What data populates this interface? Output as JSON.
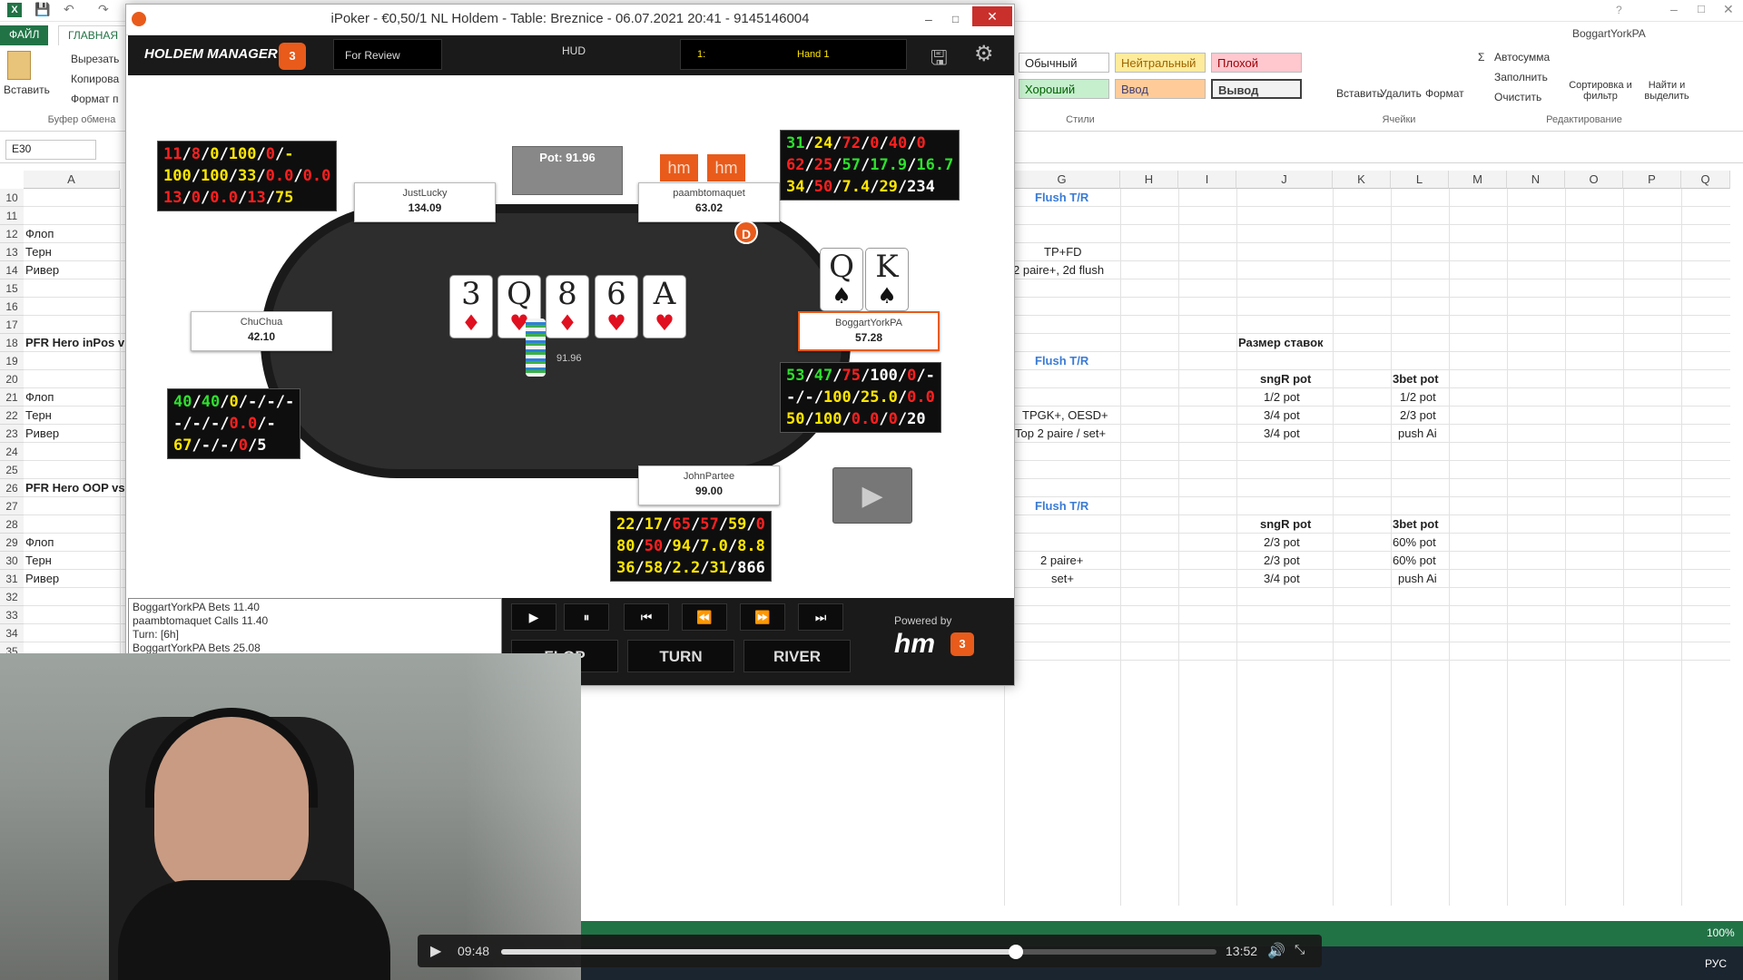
{
  "excel": {
    "tabs": {
      "file": "ФАЙЛ",
      "home": "ГЛАВНАЯ"
    },
    "user": "BoggartYorkPA",
    "clipboard": {
      "paste": "Вставить",
      "cut": "Вырезать",
      "copy": "Копирова",
      "format": "Формат п",
      "group": "Буфер обмена"
    },
    "styles": {
      "normal": "Обычный",
      "neutral": "Нейтральный",
      "bad": "Плохой",
      "good": "Хороший",
      "input": "Ввод",
      "output": "Вывод",
      "group": "Стили"
    },
    "cells_group": {
      "insert": "Вставить",
      "delete": "Удалить",
      "format": "Формат",
      "group": "Ячейки"
    },
    "editing": {
      "autosum": "Автосумма",
      "fill": "Заполнить",
      "clear": "Очистить",
      "sort": "Сортировка и фильтр",
      "find": "Найти и выделить",
      "group": "Редактирование"
    },
    "name_box": "E30",
    "columns": [
      "A",
      "G",
      "H",
      "I",
      "J",
      "K",
      "L",
      "M",
      "N",
      "O",
      "P",
      "Q"
    ],
    "rows": [
      "10",
      "11",
      "12",
      "13",
      "14",
      "15",
      "16",
      "17",
      "18",
      "19",
      "20",
      "21",
      "22",
      "23",
      "24",
      "25",
      "26",
      "27",
      "28",
      "29",
      "30",
      "31",
      "32",
      "33",
      "34",
      "35"
    ],
    "col_a": {
      "r12": "Флоп",
      "r13": "Терн",
      "r14": "Ривер",
      "r18": "PFR Hero inPos v",
      "r21": "Флоп",
      "r22": "Терн",
      "r23": "Ривер",
      "r26": "PFR Hero OOP vs",
      "r29": "Флоп",
      "r30": "Терн",
      "r31": "Ривер"
    },
    "col_g": {
      "r10": "Flush T/R",
      "r13": "TP+FD",
      "r14": "2 paire+, 2d flush",
      "r19": "Flush T/R",
      "r22": "TPGK+, OESD+",
      "r23": "Top 2 paire / set+",
      "r27": "Flush T/R",
      "r30": "2 paire+",
      "r31": "set+"
    },
    "bet_sizes_header": "Размер ставок",
    "col_j": {
      "r20": "sngR pot",
      "r21": "1/2 pot",
      "r22": "3/4 pot",
      "r23": "3/4 pot",
      "r28": "sngR pot",
      "r29": "2/3 pot",
      "r30": "2/3 pot",
      "r31": "3/4 pot"
    },
    "col_l": {
      "r20": "3bet pot",
      "r21": "1/2 pot",
      "r22": "2/3 pot",
      "r23": "push Ai",
      "r28": "3bet pot",
      "r29": "60% pot",
      "r30": "60% pot",
      "r31": "push Ai"
    },
    "zoom": "100%",
    "lang": "РУС"
  },
  "hm": {
    "title": "iPoker - €0,50/1 NL Holdem - Table: Breznice - 06.07.2021 20:41 - 9145146004",
    "logo": "HOLDEM MANAGER",
    "review_label": "For Review",
    "hud_label": "HUD",
    "hand_label": "Hand 1",
    "hand_index": "1:",
    "pot": "Pot: 91.96",
    "pot_chips": "91.96",
    "dealer": "D",
    "hm_badge": "hm",
    "seats": [
      {
        "name": "JustLucky",
        "stack": "134.09"
      },
      {
        "name": "paambtomaquet",
        "stack": "63.02"
      },
      {
        "name": "ChuChua",
        "stack": "42.10"
      },
      {
        "name": "BoggartYorkPA",
        "stack": "57.28"
      },
      {
        "name": "JohnPartee",
        "stack": "99.00"
      }
    ],
    "board": [
      {
        "rank": "3",
        "suit": "♦"
      },
      {
        "rank": "Q",
        "suit": "♥"
      },
      {
        "rank": "8",
        "suit": "♦"
      },
      {
        "rank": "6",
        "suit": "♥"
      },
      {
        "rank": "A",
        "suit": "♥"
      }
    ],
    "hero_cards": [
      {
        "rank": "Q",
        "suit": "♠"
      },
      {
        "rank": "K",
        "suit": "♠"
      }
    ],
    "hud_justlucky": [
      [
        [
          "r",
          "11"
        ],
        [
          "w",
          "/"
        ],
        [
          "r",
          "8"
        ],
        [
          "w",
          "/"
        ],
        [
          "y",
          "0"
        ],
        [
          "w",
          "/"
        ],
        [
          "y",
          "100"
        ],
        [
          "w",
          "/"
        ],
        [
          "r",
          "0"
        ],
        [
          "w",
          "/"
        ],
        [
          "y",
          "-"
        ]
      ],
      [
        [
          "y",
          "100"
        ],
        [
          "w",
          "/"
        ],
        [
          "y",
          "100"
        ],
        [
          "w",
          "/"
        ],
        [
          "y",
          "33"
        ],
        [
          "w",
          "/"
        ],
        [
          "r",
          "0.0"
        ],
        [
          "w",
          "/"
        ],
        [
          "r",
          "0.0"
        ]
      ],
      [
        [
          "r",
          "13"
        ],
        [
          "w",
          "/"
        ],
        [
          "r",
          "0"
        ],
        [
          "w",
          "/"
        ],
        [
          "r",
          "0.0"
        ],
        [
          "w",
          "/"
        ],
        [
          "r",
          "13"
        ],
        [
          "w",
          "/"
        ],
        [
          "y",
          "75"
        ]
      ]
    ],
    "hud_paamb": [
      [
        [
          "g",
          "31"
        ],
        [
          "w",
          "/"
        ],
        [
          "y",
          "24"
        ],
        [
          "w",
          "/"
        ],
        [
          "r",
          "72"
        ],
        [
          "w",
          "/"
        ],
        [
          "r",
          "0"
        ],
        [
          "w",
          "/"
        ],
        [
          "r",
          "40"
        ],
        [
          "w",
          "/"
        ],
        [
          "r",
          "0"
        ]
      ],
      [
        [
          "r",
          "62"
        ],
        [
          "w",
          "/"
        ],
        [
          "r",
          "25"
        ],
        [
          "w",
          "/"
        ],
        [
          "g",
          "57"
        ],
        [
          "w",
          "/"
        ],
        [
          "g",
          "17.9"
        ],
        [
          "w",
          "/"
        ],
        [
          "g",
          "16.7"
        ]
      ],
      [
        [
          "y",
          "34"
        ],
        [
          "w",
          "/"
        ],
        [
          "r",
          "50"
        ],
        [
          "w",
          "/"
        ],
        [
          "y",
          "7.4"
        ],
        [
          "w",
          "/"
        ],
        [
          "y",
          "29"
        ],
        [
          "w",
          "/"
        ],
        [
          "w",
          "234"
        ]
      ]
    ],
    "hud_chuchua": [
      [
        [
          "g",
          "40"
        ],
        [
          "w",
          "/"
        ],
        [
          "g",
          "40"
        ],
        [
          "w",
          "/"
        ],
        [
          "y",
          "0"
        ],
        [
          "w",
          "/"
        ],
        [
          "w",
          "-"
        ],
        [
          "w",
          "/"
        ],
        [
          "w",
          "-"
        ],
        [
          "w",
          "/"
        ],
        [
          "w",
          "-"
        ]
      ],
      [
        [
          "w",
          "-"
        ],
        [
          "w",
          "/"
        ],
        [
          "w",
          "-"
        ],
        [
          "w",
          "/"
        ],
        [
          "w",
          "-"
        ],
        [
          "w",
          "/"
        ],
        [
          "r",
          "0.0"
        ],
        [
          "w",
          "/"
        ],
        [
          "w",
          "-"
        ]
      ],
      [
        [
          "y",
          "67"
        ],
        [
          "w",
          "/"
        ],
        [
          "w",
          "-"
        ],
        [
          "w",
          "/"
        ],
        [
          "w",
          "-"
        ],
        [
          "w",
          "/"
        ],
        [
          "r",
          "0"
        ],
        [
          "w",
          "/"
        ],
        [
          "w",
          "5"
        ]
      ]
    ],
    "hud_boggart": [
      [
        [
          "g",
          "53"
        ],
        [
          "w",
          "/"
        ],
        [
          "g",
          "47"
        ],
        [
          "w",
          "/"
        ],
        [
          "r",
          "75"
        ],
        [
          "w",
          "/"
        ],
        [
          "w",
          "100"
        ],
        [
          "w",
          "/"
        ],
        [
          "r",
          "0"
        ],
        [
          "w",
          "/"
        ],
        [
          "w",
          "-"
        ]
      ],
      [
        [
          "w",
          "-"
        ],
        [
          "w",
          "/"
        ],
        [
          "w",
          "-"
        ],
        [
          "w",
          "/"
        ],
        [
          "y",
          "100"
        ],
        [
          "w",
          "/"
        ],
        [
          "y",
          "25.0"
        ],
        [
          "w",
          "/"
        ],
        [
          "r",
          "0.0"
        ]
      ],
      [
        [
          "y",
          "50"
        ],
        [
          "w",
          "/"
        ],
        [
          "y",
          "100"
        ],
        [
          "w",
          "/"
        ],
        [
          "r",
          "0.0"
        ],
        [
          "w",
          "/"
        ],
        [
          "r",
          "0"
        ],
        [
          "w",
          "/"
        ],
        [
          "w",
          "20"
        ]
      ]
    ],
    "hud_john": [
      [
        [
          "y",
          "22"
        ],
        [
          "w",
          "/"
        ],
        [
          "y",
          "17"
        ],
        [
          "w",
          "/"
        ],
        [
          "r",
          "65"
        ],
        [
          "w",
          "/"
        ],
        [
          "r",
          "57"
        ],
        [
          "w",
          "/"
        ],
        [
          "y",
          "59"
        ],
        [
          "w",
          "/"
        ],
        [
          "r",
          "0"
        ]
      ],
      [
        [
          "y",
          "80"
        ],
        [
          "w",
          "/"
        ],
        [
          "r",
          "50"
        ],
        [
          "w",
          "/"
        ],
        [
          "y",
          "94"
        ],
        [
          "w",
          "/"
        ],
        [
          "y",
          "7.0"
        ],
        [
          "w",
          "/"
        ],
        [
          "y",
          "8.8"
        ]
      ],
      [
        [
          "y",
          "36"
        ],
        [
          "w",
          "/"
        ],
        [
          "y",
          "58"
        ],
        [
          "w",
          "/"
        ],
        [
          "y",
          "2.2"
        ],
        [
          "w",
          "/"
        ],
        [
          "y",
          "31"
        ],
        [
          "w",
          "/"
        ],
        [
          "w",
          "866"
        ]
      ]
    ],
    "log_lines": [
      "BoggartYorkPA Bets 11.40",
      "paambtomaquet Calls 11.40",
      "Turn: [6h]",
      "BoggartYorkPA Bets 25.08"
    ],
    "streets": [
      "FLOP",
      "TURN",
      "RIVER"
    ],
    "powered_by": "Powered by",
    "powered_logo": "hm"
  },
  "video": {
    "current": "09:48",
    "duration": "13:52",
    "progress": 0.72
  }
}
